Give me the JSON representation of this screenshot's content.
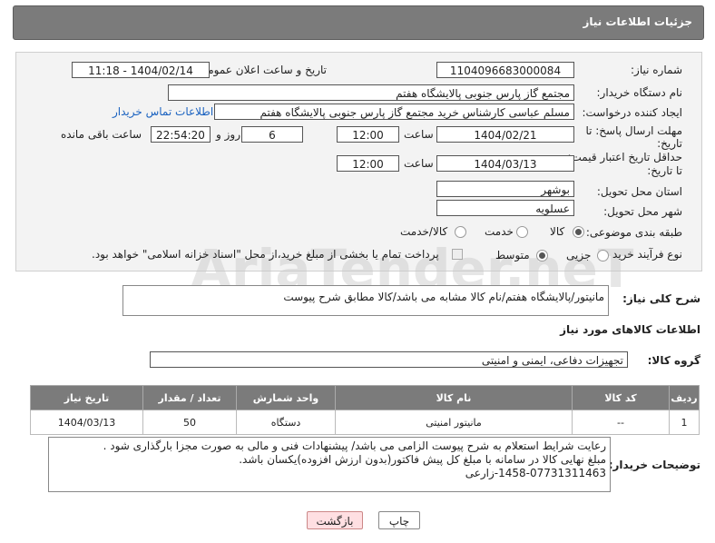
{
  "header": {
    "title": "جزئیات اطلاعات نیاز"
  },
  "form": {
    "need_number_label": "شماره نیاز:",
    "need_number_value": "1104096683000084",
    "announce_label": "تاریخ و ساعت اعلان عمومی:",
    "announce_value": "1404/02/14 - 11:18",
    "buyer_org_label": "نام دستگاه خریدار:",
    "buyer_org_value": "مجتمع گاز پارس جنوبی  پالایشگاه هفتم",
    "requester_label": "ایجاد کننده درخواست:",
    "requester_value": "مسلم عباسی کارشناس خرید مجتمع گاز پارس جنوبی  پالایشگاه هفتم",
    "contact_link": "اطلاعات تماس خریدار",
    "deadline_label_1": "مهلت ارسال پاسخ: تا",
    "deadline_label_2": "تاریخ:",
    "deadline_date": "1404/02/21",
    "time_label": "ساعت",
    "deadline_time": "12:00",
    "days_value": "6",
    "days_label": "روز و",
    "remaining_time": "22:54:20",
    "remaining_label": "ساعت باقی مانده",
    "validity_label_1": "حداقل تاریخ اعتبار قیمت:",
    "validity_label_2": "تا تاریخ:",
    "validity_date": "1404/03/13",
    "validity_time": "12:00",
    "province_label": "استان محل تحویل:",
    "province_value": "بوشهر",
    "city_label": "شهر محل تحویل:",
    "city_value": "عسلویه",
    "category_label": "طبقه بندی موضوعی:",
    "category_options": [
      "کالا",
      "خدمت",
      "کالا/خدمت"
    ],
    "process_label": "نوع فرآیند خرید :",
    "process_options": [
      "جزیی",
      "متوسط"
    ],
    "payment_note": "پرداخت تمام یا بخشی از مبلغ خرید،از محل \"اسناد خزانه اسلامی\" خواهد بود."
  },
  "watermark": {
    "text": "AriaTender.neT"
  },
  "summary": {
    "label": "شرح کلی نیاز:",
    "value": "مانیتور/پالایشگاه هفتم/نام کالا مشابه می باشد/کالا مطابق شرح پیوست"
  },
  "goods_section_title": "اطلاعات کالاهای مورد نیاز",
  "goods_group": {
    "label": "گروه کالا:",
    "value": "تجهیزات دفاعی، ایمنی و امنیتی"
  },
  "table": {
    "headers": [
      "ردیف",
      "کد کالا",
      "نام کالا",
      "واحد شمارش",
      "تعداد / مقدار",
      "تاریخ نیاز"
    ],
    "rows": [
      [
        "1",
        "--",
        "مانیتور امنیتی",
        "دستگاه",
        "50",
        "1404/03/13"
      ]
    ]
  },
  "buyer_notes": {
    "label": "توضیحات خریدار:",
    "lines": [
      "رعایت شرایط استعلام به شرح پیوست الزامی می باشد/ پیشنهادات فنی و مالی به صورت مجزا بارگذاری شود .",
      "مبلغ نهایی کالا در سامانه با مبلغ کل پیش فاکتور(بدون ارزش افزوده)یکسان باشد.",
      "1458-07731311463-زارعی"
    ]
  },
  "buttons": {
    "print": "چاپ",
    "back": "بازگشت"
  }
}
